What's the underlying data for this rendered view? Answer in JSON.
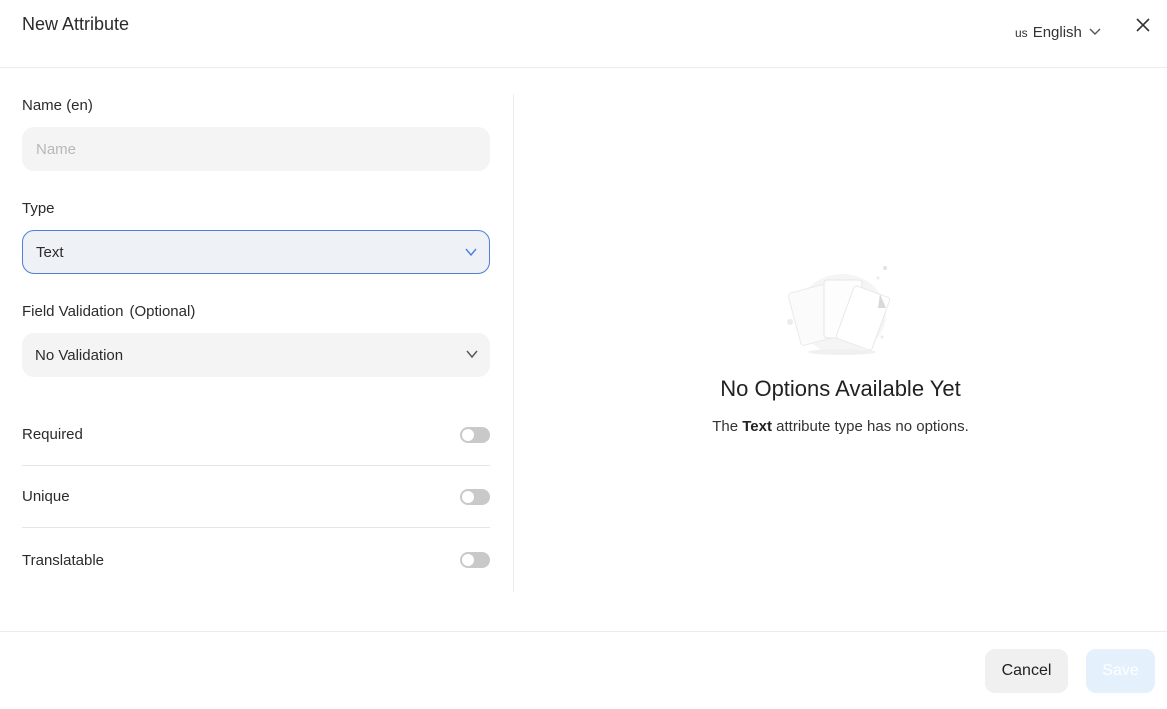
{
  "header": {
    "title": "New Attribute",
    "language": {
      "country_code": "us",
      "label": "English"
    }
  },
  "form": {
    "name": {
      "label": "Name",
      "lang_suffix": "(en)",
      "placeholder": "Name",
      "value": ""
    },
    "type": {
      "label": "Type",
      "value": "Text"
    },
    "validation": {
      "label": "Field Validation",
      "optional": "(Optional)",
      "value": "No Validation"
    },
    "toggles": [
      {
        "label": "Required",
        "checked": false
      },
      {
        "label": "Unique",
        "checked": false
      },
      {
        "label": "Translatable",
        "checked": false
      }
    ]
  },
  "empty_state": {
    "title": "No Options Available Yet",
    "sub_prefix": "The",
    "sub_type": "Text",
    "sub_suffix": "attribute type has no options."
  },
  "footer": {
    "cancel_label": "Cancel",
    "save_label": "Save"
  },
  "colors": {
    "accent": "#4f7fd6",
    "save_bg": "#e4f0fc",
    "field_bg": "#f4f4f4"
  },
  "icons": {
    "close": "close-icon",
    "chevron": "chevron-down-icon"
  }
}
